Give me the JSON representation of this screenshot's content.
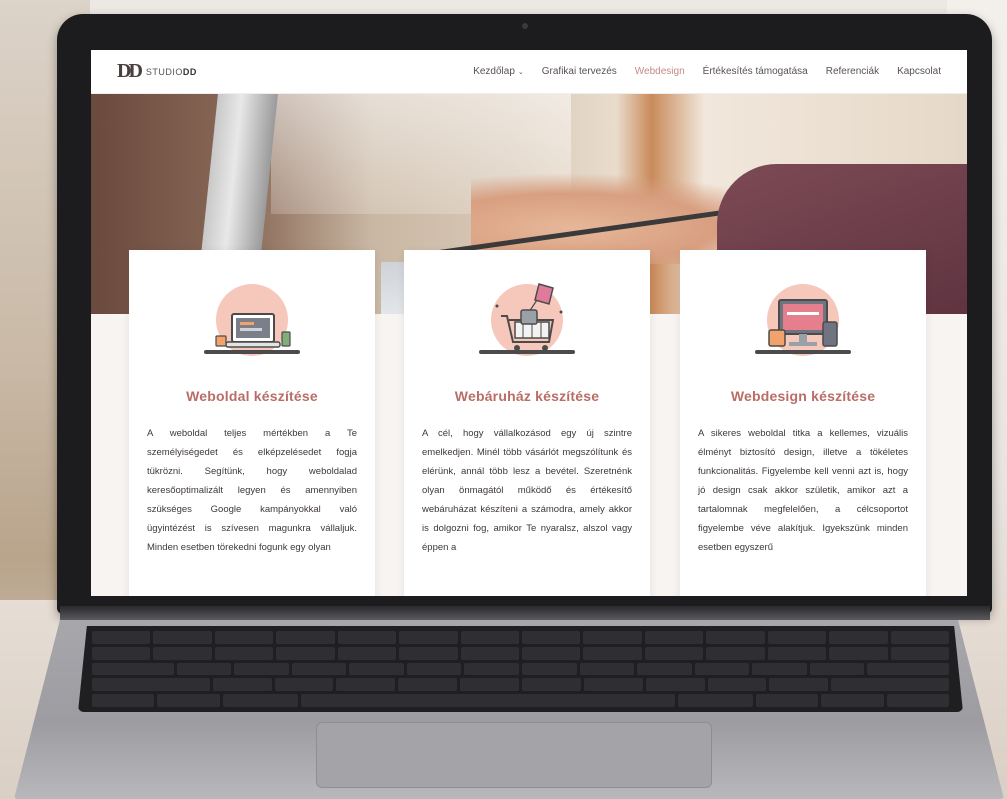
{
  "site": {
    "logo": {
      "mark": "DD",
      "text_prefix": "STUDIO",
      "text_suffix": "DD"
    },
    "nav": [
      {
        "label": "Kezdőlap",
        "has_dropdown": true,
        "active": false
      },
      {
        "label": "Grafikai tervezés",
        "has_dropdown": false,
        "active": false
      },
      {
        "label": "Webdesign",
        "has_dropdown": false,
        "active": true
      },
      {
        "label": "Értékesítés támogatása",
        "has_dropdown": false,
        "active": false
      },
      {
        "label": "Referenciák",
        "has_dropdown": false,
        "active": false
      },
      {
        "label": "Kapcsolat",
        "has_dropdown": false,
        "active": false
      }
    ],
    "colors": {
      "accent": "#c48a86",
      "title": "#b86e67",
      "circle": "#f6c7bb"
    }
  },
  "cards": [
    {
      "icon": "laptop-desk-icon",
      "title": "Weboldal készítése",
      "text": "A weboldal teljes mértékben a Te személyiségedet és elképzelésedet fogja tükrözni. Segítünk, hogy weboldalad keresőoptimalizált legyen és amennyiben szükséges Google kampányokkal való ügyintézést is szívesen magunkra vállaljuk. Minden esetben törekedni fogunk egy olyan"
    },
    {
      "icon": "shopping-cart-icon",
      "title": "Webáruház készítése",
      "text": "A cél, hogy vállalkozásod egy új szintre emelkedjen. Minél több vásárlót megszólítunk és elérünk, annál több lesz a bevétel. Szeretnénk olyan önmagától működő és értékesítő webáruházat készíteni a számodra, amely akkor is dolgozni fog, amikor Te nyaralsz, alszol vagy éppen a"
    },
    {
      "icon": "devices-icon",
      "title": "Webdesign készítése",
      "text": "A sikeres weboldal titka a kellemes, vizuális élményt biztosító design, illetve a tökéletes funkcionalitás. Figyelembe kell venni azt is, hogy jó design csak akkor születik, amikor azt a tartalomnak megfelelően, a célcsoportot figyelembe véve alakítjuk. Igyekszünk minden esetben egyszerű"
    }
  ]
}
